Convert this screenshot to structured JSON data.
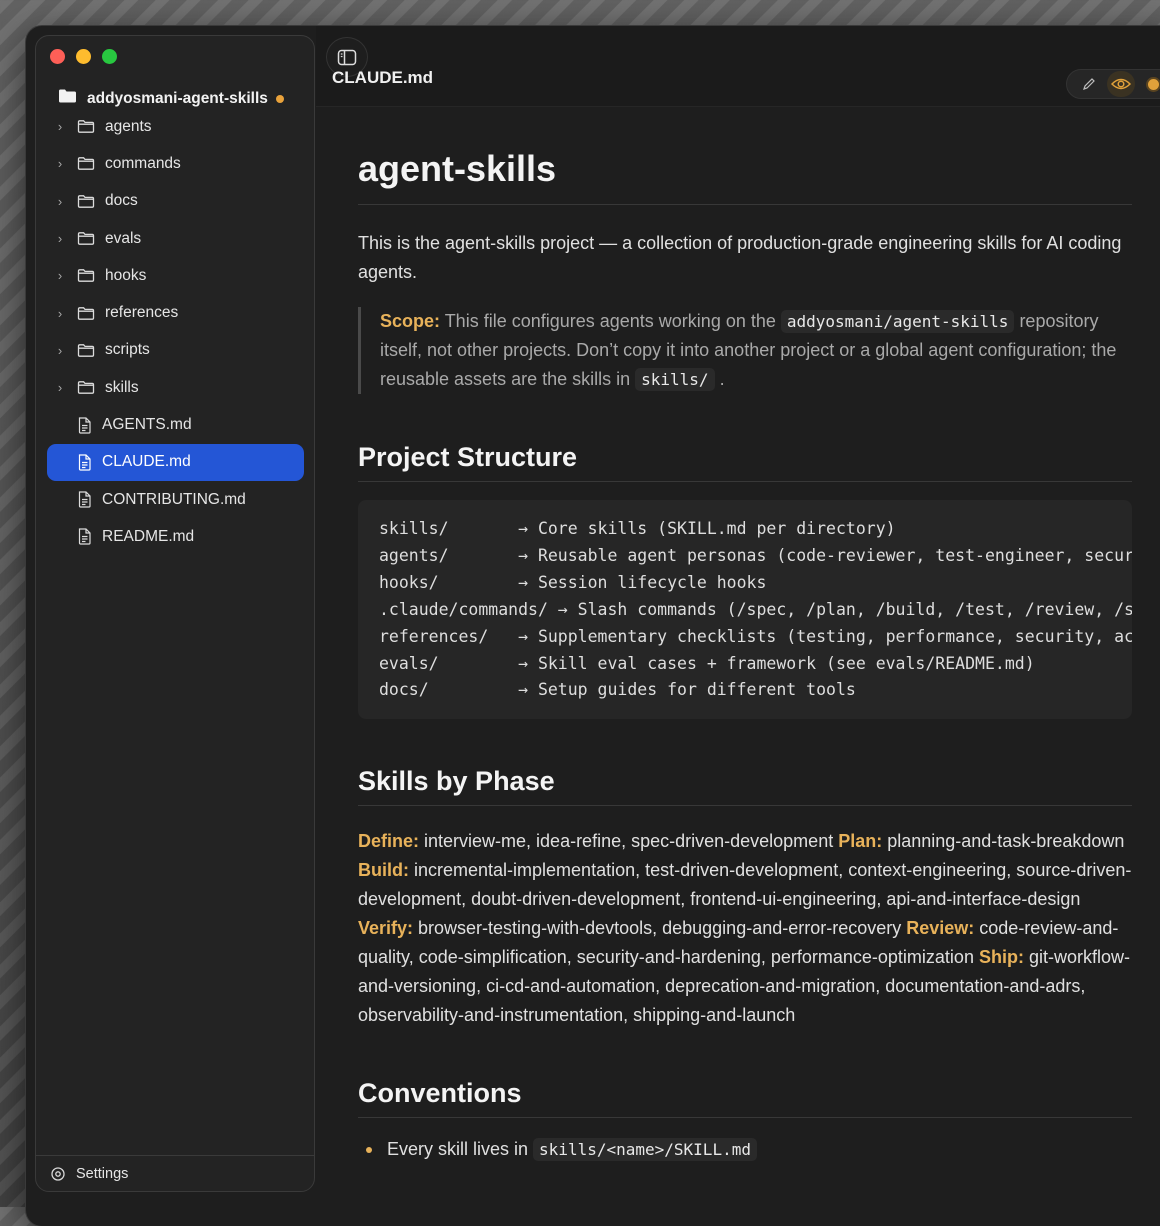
{
  "sidebar": {
    "root": {
      "label": "addyosmani-agent-skills",
      "modified": true
    },
    "folders": [
      {
        "label": "agents"
      },
      {
        "label": "commands"
      },
      {
        "label": "docs"
      },
      {
        "label": "evals"
      },
      {
        "label": "hooks"
      },
      {
        "label": "references"
      },
      {
        "label": "scripts"
      },
      {
        "label": "skills"
      }
    ],
    "files": [
      {
        "label": "AGENTS.md"
      },
      {
        "label": "CLAUDE.md",
        "active": true
      },
      {
        "label": "CONTRIBUTING.md"
      },
      {
        "label": "README.md"
      }
    ],
    "settings_label": "Settings"
  },
  "toolbar": {
    "title": "CLAUDE.md",
    "accent": "#e0a13a"
  },
  "doc": {
    "h1": "agent-skills",
    "intro": "This is the agent-skills project — a collection of production-grade engineering skills for AI coding agents.",
    "scope": {
      "label": "Scope:",
      "t1": " This file configures agents working on the ",
      "code1": "addyosmani/agent-skills",
      "t2": " repository itself, not other projects. Don’t copy it into another project or a global agent configuration; the reusable assets are the skills in ",
      "code2": "skills/",
      "t3": " ."
    },
    "structure_heading": "Project Structure",
    "structure_lines": [
      "skills/       → Core skills (SKILL.md per directory)",
      "agents/       → Reusable agent personas (code-reviewer, test-engineer, security-auditor)",
      "hooks/        → Session lifecycle hooks",
      ".claude/commands/ → Slash commands (/spec, /plan, /build, /test, /review, /ship)",
      "references/   → Supplementary checklists (testing, performance, security, accessibility)",
      "evals/        → Skill eval cases + framework (see evals/README.md)",
      "docs/         → Setup guides for different tools"
    ],
    "phases_heading": "Skills by Phase",
    "phases": [
      {
        "label": "Define:",
        "text": " interview-me, idea-refine, spec-driven-development "
      },
      {
        "label": "Plan:",
        "text": " planning-and-task-breakdown "
      },
      {
        "label": "Build:",
        "text": " incremental-implementation, test-driven-development, context-engineering, source-driven-development, doubt-driven-development, frontend-ui-engineering, api-and-interface-design "
      },
      {
        "label": "Verify:",
        "text": " browser-testing-with-devtools, debugging-and-error-recovery "
      },
      {
        "label": "Review:",
        "text": " code-review-and-quality, code-simplification, security-and-hardening, performance-optimization "
      },
      {
        "label": "Ship:",
        "text": " git-workflow-and-versioning, ci-cd-and-automation, deprecation-and-migration, documentation-and-adrs, observability-and-instrumentation, shipping-and-launch"
      }
    ],
    "conventions_heading": "Conventions",
    "conventions": [
      {
        "text": "Every skill lives in ",
        "code": "skills/<name>/SKILL.md"
      }
    ]
  }
}
